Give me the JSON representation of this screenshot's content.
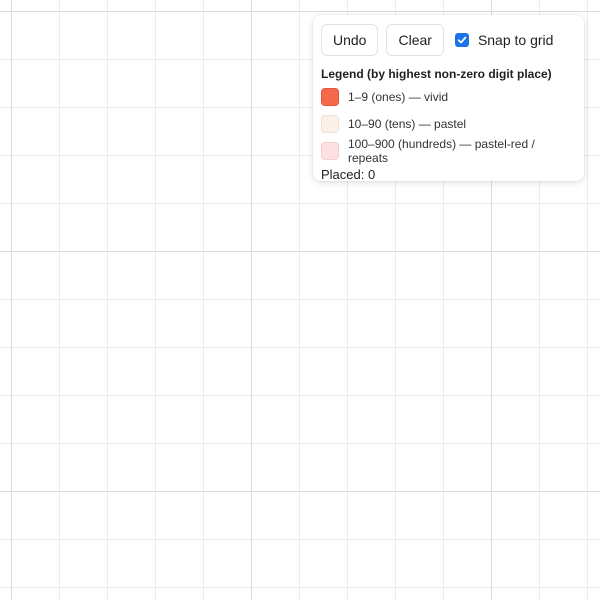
{
  "toolbar": {
    "undo_label": "Undo",
    "clear_label": "Clear",
    "snap_label": "Snap to grid",
    "snap_checked": true
  },
  "legend": {
    "title": "Legend (by highest non-zero digit place)",
    "items": [
      {
        "label": "1–9 (ones) — vivid",
        "color": "#f4694c",
        "border": "#e5573a"
      },
      {
        "label": "10–90 (tens) — pastel",
        "color": "#fdf0e6",
        "border": "#f3e1d3"
      },
      {
        "label": "100–900 (hundreds) — pastel-red / repeats",
        "color": "#fde0e0",
        "border": "#f4cfcf"
      }
    ]
  },
  "status": {
    "placed_text": "Placed: 0"
  },
  "colors": {
    "accent": "#1a73e8",
    "grid_major": "#dcdcdc",
    "grid_minor": "#ececec"
  }
}
